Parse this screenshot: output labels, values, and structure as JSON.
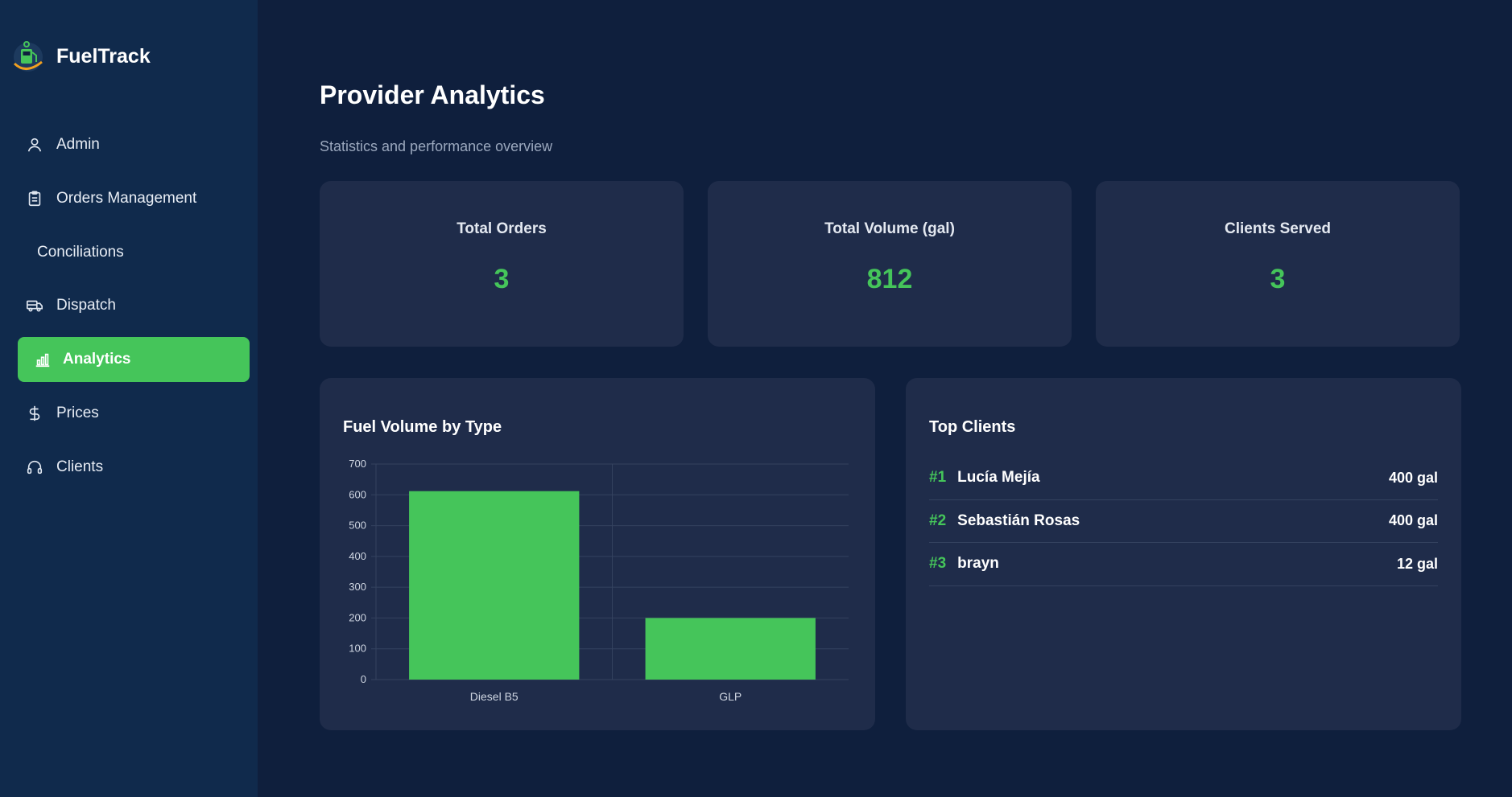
{
  "app": {
    "name": "FuelTrack"
  },
  "sidebar": {
    "items": [
      {
        "label": "Admin",
        "icon": "user-icon"
      },
      {
        "label": "Orders Management",
        "icon": "clipboard-icon"
      },
      {
        "label": "Conciliations",
        "icon": ""
      },
      {
        "label": "Dispatch",
        "icon": "truck-icon"
      },
      {
        "label": "Analytics",
        "icon": "bar-chart-icon",
        "active": true
      },
      {
        "label": "Prices",
        "icon": "dollar-icon"
      },
      {
        "label": "Clients",
        "icon": "headset-icon"
      }
    ]
  },
  "main": {
    "title": "Provider Analytics",
    "subtitle": "Statistics and performance overview",
    "stats": [
      {
        "label": "Total Orders",
        "value": "3"
      },
      {
        "label": "Total Volume (gal)",
        "value": "812"
      },
      {
        "label": "Clients Served",
        "value": "3"
      }
    ],
    "chart_panel": {
      "title": "Fuel Volume by Type"
    },
    "top_clients": {
      "title": "Top Clients",
      "rows": [
        {
          "rank": "#1",
          "name": "Lucía Mejía",
          "volume": "400 gal"
        },
        {
          "rank": "#2",
          "name": "Sebastián Rosas",
          "volume": "400 gal"
        },
        {
          "rank": "#3",
          "name": "brayn",
          "volume": "12 gal"
        }
      ]
    }
  },
  "colors": {
    "accent": "#45c55a",
    "background": "#0f1f3d",
    "sidebar": "#102a4c",
    "card": "#1f2c4a"
  },
  "chart_data": {
    "type": "bar",
    "title": "Fuel Volume by Type",
    "categories": [
      "Diesel B5",
      "GLP"
    ],
    "values": [
      612,
      200
    ],
    "ylim": [
      0,
      700
    ],
    "yticks": [
      0,
      100,
      200,
      300,
      400,
      500,
      600,
      700
    ],
    "xlabel": "",
    "ylabel": "",
    "grid": true,
    "color": "#45c55a"
  }
}
